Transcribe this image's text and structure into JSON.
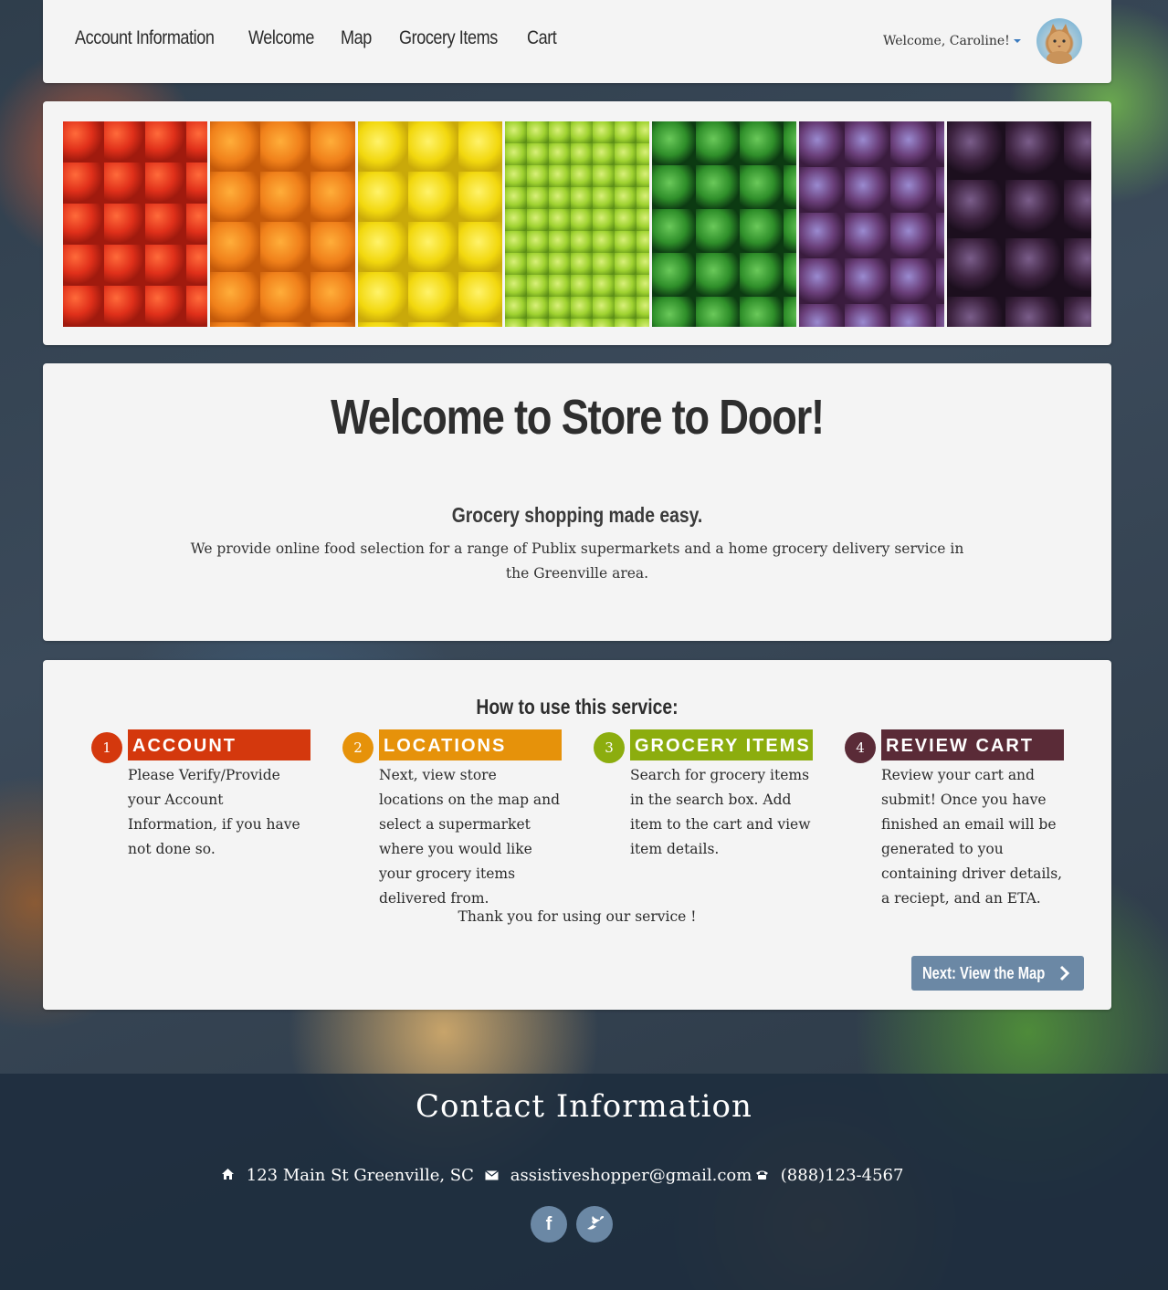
{
  "nav": {
    "links": [
      "Account Information",
      "Welcome",
      "Map",
      "Grocery Items",
      "Cart"
    ],
    "welcome_user": "Welcome, Caroline!"
  },
  "hero": {
    "title": "Welcome to Store to Door!",
    "subtitle": "Grocery shopping made easy.",
    "description": "We provide online food selection for a range of Publix supermarkets and a home grocery delivery service in the Greenville area."
  },
  "how": {
    "title": "How to use this service:",
    "steps": [
      {
        "num": "1",
        "title": "ACCOUNT",
        "color": "#d4380d",
        "text": "Please Verify/Provide your Account Information, if you have not done so."
      },
      {
        "num": "2",
        "title": "LOCATIONS",
        "color": "#e6920a",
        "text": "Next, view store locations on the map and select a supermarket where you would like your grocery items delivered from."
      },
      {
        "num": "3",
        "title": "GROCERY ITEMS",
        "color": "#8cad0e",
        "text": "Search for grocery items in the search box. Add item to the cart and view item details."
      },
      {
        "num": "4",
        "title": "REVIEW CART",
        "color": "#5a2b37",
        "text": "Review your cart and submit! Once you have finished an email will be generated to you containing driver details, a reciept, and an ETA."
      }
    ],
    "thanks": "Thank you for using our service !",
    "next_button": "Next: View the Map"
  },
  "footer": {
    "title": "Contact Information",
    "address": "123 Main St Greenville, SC",
    "email": "assistiveshopper@gmail.com",
    "phone": "(888)123-4567",
    "icons": [
      "home-icon",
      "envelope-icon",
      "phone-icon",
      "facebook-icon",
      "twitter-icon"
    ]
  }
}
